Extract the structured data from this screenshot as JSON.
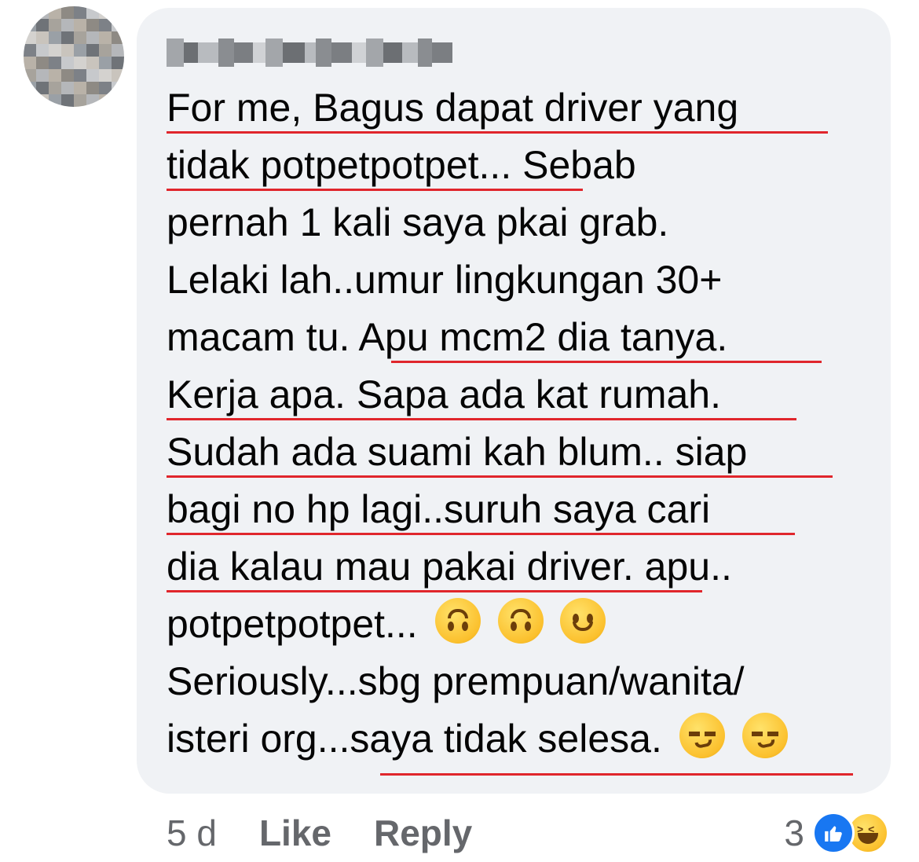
{
  "comment": {
    "author": "",
    "lines": [
      "For me, Bagus dapat driver yang",
      "tidak potpetpotpet... Sebab",
      "pernah 1 kali saya pkai grab.",
      "Lelaki lah..umur lingkungan 30+",
      "macam tu. Apu mcm2 dia tanya.",
      "Kerja apa. Sapa ada kat rumah.",
      "Sudah ada suami kah blum.. siap",
      "bagi no hp lagi..suruh saya cari",
      "dia kalau mau pakai driver. apu..",
      "potpetpotpet...",
      "Seriously...sbg prempuan/wanita/",
      "isteri org...saya tidak selesa."
    ],
    "emojis_line10": [
      "upside-down-face-icon",
      "upside-down-face-icon",
      "smiling-face-icon"
    ],
    "emojis_line12": [
      "smirking-face-icon",
      "smirking-face-icon"
    ]
  },
  "actions": {
    "time": "5 d",
    "like_label": "Like",
    "reply_label": "Reply"
  },
  "reactions": {
    "count": "3",
    "icons": [
      "like-reaction-icon",
      "haha-reaction-icon"
    ]
  },
  "colors": {
    "bubble": "#f0f2f5",
    "text": "#050505",
    "secondary": "#65676b",
    "underline": "#e0262c",
    "like_blue": "#1877f2"
  }
}
